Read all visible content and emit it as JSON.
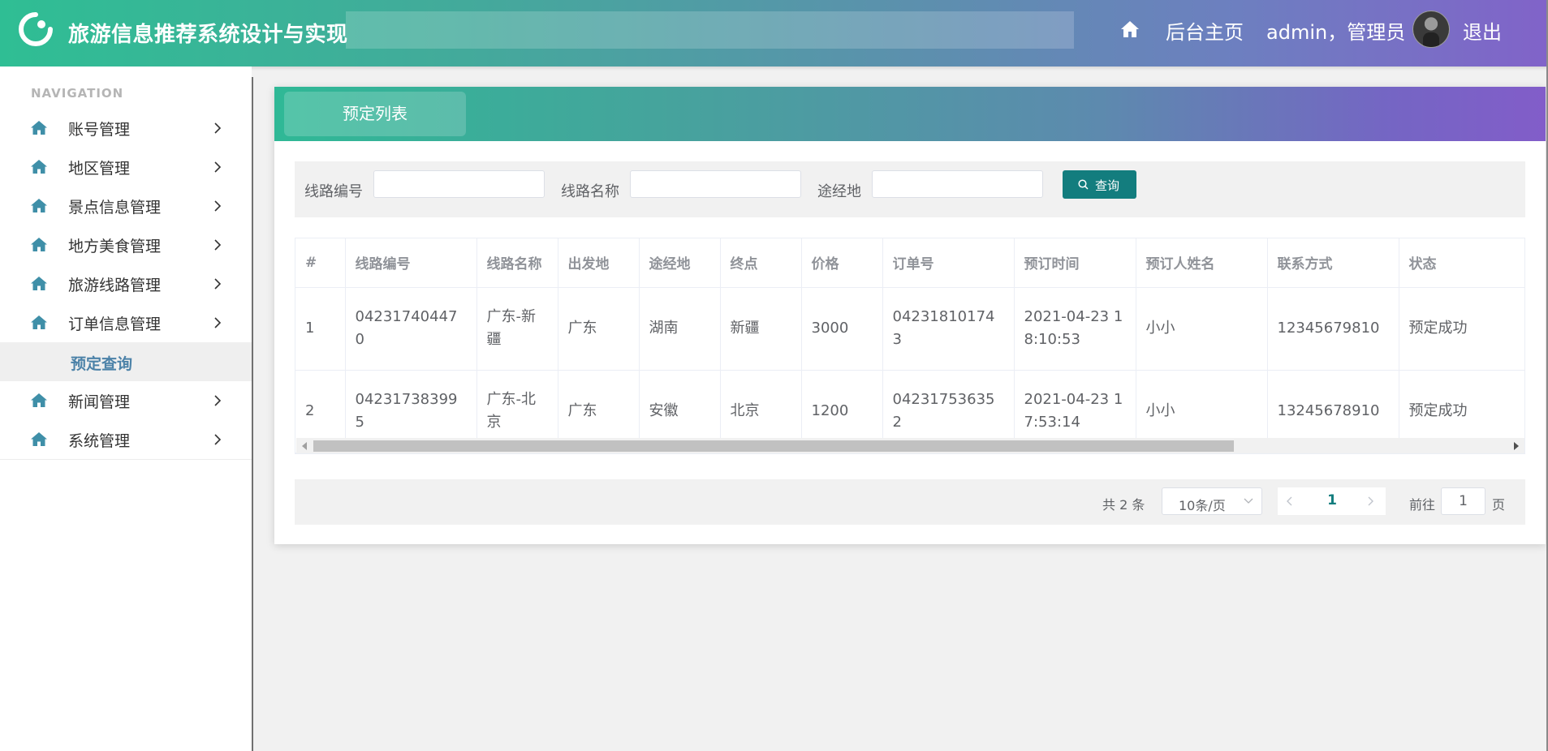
{
  "header": {
    "app_title": "旅游信息推荐系统设计与实现",
    "home_link": "后台主页",
    "user_label": "admin，管理员",
    "logout": "退出"
  },
  "sidebar": {
    "caption": "NAVIGATION",
    "items": [
      {
        "label": "账号管理",
        "icon": "home-icon"
      },
      {
        "label": "地区管理",
        "icon": "home-icon"
      },
      {
        "label": "景点信息管理",
        "icon": "home-icon"
      },
      {
        "label": "地方美食管理",
        "icon": "home-icon"
      },
      {
        "label": "旅游线路管理",
        "icon": "home-icon"
      },
      {
        "label": "订单信息管理",
        "icon": "home-icon"
      },
      {
        "label": "新闻管理",
        "icon": "home-icon"
      },
      {
        "label": "系统管理",
        "icon": "home-icon"
      }
    ],
    "sub_item": "预定查询"
  },
  "page": {
    "tab_title": "预定列表"
  },
  "search": {
    "route_no_label": "线路编号",
    "route_no_value": "",
    "route_name_label": "线路名称",
    "route_name_value": "",
    "via_label": "途经地",
    "via_value": "",
    "button": "查询"
  },
  "table": {
    "columns": [
      "#",
      "线路编号",
      "线路名称",
      "出发地",
      "途经地",
      "终点",
      "价格",
      "订单号",
      "预订时间",
      "预订人姓名",
      "联系方式",
      "状态"
    ],
    "rows": [
      [
        "1",
        "042317404470",
        "广东-新疆",
        "广东",
        "湖南",
        "新疆",
        "3000",
        "042318101743",
        "2021-04-23 18:10:53",
        "小小",
        "12345679810",
        "预定成功"
      ],
      [
        "2",
        "042317383995",
        "广东-北京",
        "广东",
        "安徽",
        "北京",
        "1200",
        "042317536352",
        "2021-04-23 17:53:14",
        "小小",
        "13245678910",
        "预定成功"
      ]
    ]
  },
  "pagination": {
    "total": "共 2 条",
    "page_size": "10条/页",
    "current_page": "1",
    "goto_label": "前往",
    "goto_value": "1",
    "page_suffix": "页"
  },
  "colors": {
    "accent": "#137d7e",
    "header_gradient_start": "#2fbe94",
    "header_gradient_end": "#8163c9",
    "sub_item_text": "#4c82a8"
  }
}
